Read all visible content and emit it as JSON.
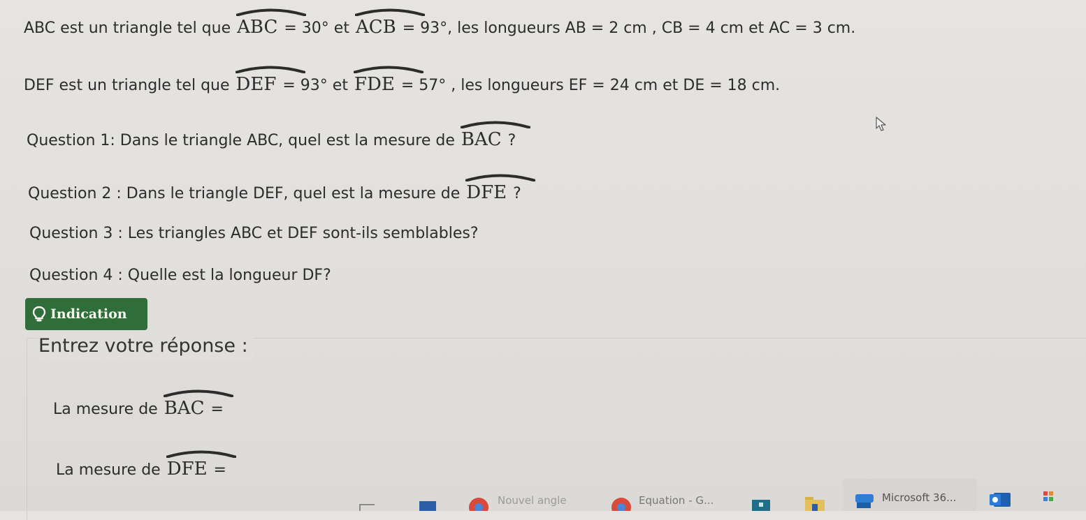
{
  "problem": {
    "line1": {
      "t1": "ABC est un triangle tel que ",
      "a1": "ABC",
      "v1": " = 30°",
      "t2": " et ",
      "a2": "ACB",
      "v2": " = 93°",
      "t3": ", les longueurs AB = 2 cm , CB = 4 cm et AC = 3 cm."
    },
    "line2": {
      "t1": "DEF est un triangle tel que ",
      "a1": "DEF",
      "v1": " = 93°",
      "t2": " et ",
      "a2": "FDE",
      "v2": " = 57°",
      "t3": " , les longueurs EF = 24 cm et DE = 18 cm."
    }
  },
  "questions": {
    "q1": {
      "text": "Question 1: Dans le triangle ABC, quel est la mesure de ",
      "angle": "BAC",
      "suffix": " ?"
    },
    "q2": {
      "text": "Question 2 : Dans le triangle DEF, quel est la mesure de ",
      "angle": "DFE",
      "suffix": " ?"
    },
    "q3": {
      "text": "Question 3 : Les triangles ABC et DEF sont-ils semblables?"
    },
    "q4": {
      "text": "Question 4 : Quelle est la longueur DF?"
    }
  },
  "indication": {
    "label": "Indication",
    "icon": "lightbulb-icon"
  },
  "answer": {
    "title": "Entrez votre réponse :",
    "field1": {
      "prefix": "La mesure de ",
      "angle": "BAC",
      "suffix": " ="
    },
    "field2": {
      "prefix": "La mesure de ",
      "angle": "DFE",
      "suffix": " ="
    }
  },
  "taskbar": {
    "item_angle": "Nouvel angle",
    "item_equation": "Equation - G...",
    "item_microsoft": "Microsoft 36..."
  },
  "colors": {
    "indication_bg": "#2f6d3a",
    "background": "#e1dfdc",
    "text": "#2c2c2c"
  }
}
